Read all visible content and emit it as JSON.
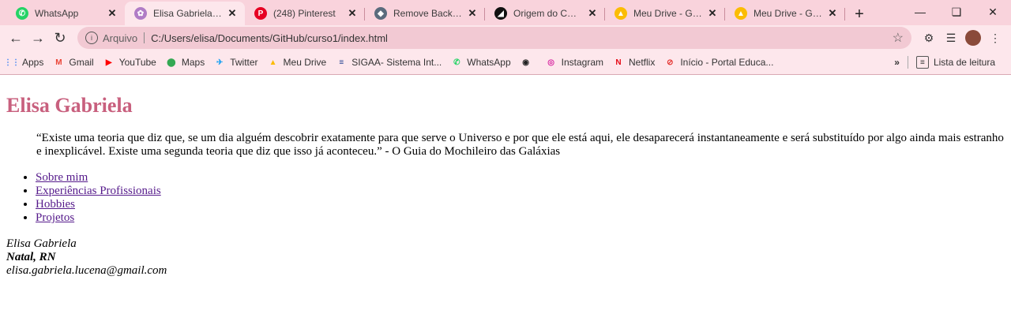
{
  "tabs": [
    {
      "title": "WhatsApp",
      "icon": "whatsapp-icon",
      "color": "#25d366"
    },
    {
      "title": "Elisa Gabriela Luce",
      "icon": "page-icon",
      "color": "#b07cc6",
      "active": true
    },
    {
      "title": "(248) Pinterest",
      "icon": "pinterest-icon",
      "color": "#e60023"
    },
    {
      "title": "Remove Backgrou",
      "icon": "removebg-icon",
      "color": "#5a6b7d"
    },
    {
      "title": "Origem do CSS | R",
      "icon": "alura-icon",
      "color": "#111111"
    },
    {
      "title": "Meu Drive - Goog",
      "icon": "drive-icon",
      "color": "#fbbc04"
    },
    {
      "title": "Meu Drive - Goog",
      "icon": "drive-icon",
      "color": "#fbbc04"
    }
  ],
  "address": {
    "label": "Arquivo",
    "url": "C:/Users/elisa/Documents/GitHub/curso1/index.html"
  },
  "bookmarks": [
    {
      "label": "Apps",
      "icon": "apps-icon",
      "color": "#4285f4"
    },
    {
      "label": "Gmail",
      "icon": "gmail-icon",
      "color": "#ea4335"
    },
    {
      "label": "YouTube",
      "icon": "youtube-icon",
      "color": "#ff0000"
    },
    {
      "label": "Maps",
      "icon": "maps-icon",
      "color": "#34a853"
    },
    {
      "label": "Twitter",
      "icon": "twitter-icon",
      "color": "#1da1f2"
    },
    {
      "label": "Meu Drive",
      "icon": "drive-icon",
      "color": "#fbbc04"
    },
    {
      "label": "SIGAA- Sistema Int...",
      "icon": "sigaa-icon",
      "color": "#1a3d8f"
    },
    {
      "label": "WhatsApp",
      "icon": "whatsapp-icon",
      "color": "#25d366"
    },
    {
      "label": "",
      "icon": "globe-icon",
      "color": "#222222"
    },
    {
      "label": "Instagram",
      "icon": "instagram-icon",
      "color": "#d6249f"
    },
    {
      "label": "Netflix",
      "icon": "netflix-icon",
      "color": "#e50914"
    },
    {
      "label": "Início - Portal Educa...",
      "icon": "portal-icon",
      "color": "#e53935"
    }
  ],
  "reading_list": "Lista de leitura",
  "page": {
    "heading": "Elisa Gabriela",
    "quote": "“Existe uma teoria que diz que, se um dia alguém descobrir exatamente para que serve o Universo e por que ele está aqui, ele desaparecerá instantaneamente e será substituído por algo ainda mais estranho e inexplicável. Existe uma segunda teoria que diz que isso já aconteceu.” - O Guia do Mochileiro das Galáxias",
    "links": [
      "Sobre mim",
      "Experiências Profissionais",
      "Hobbies",
      "Projetos"
    ],
    "address": {
      "name": "Elisa Gabriela",
      "city": "Natal, RN",
      "email": "elisa.gabriela.lucena@gmail.com"
    }
  }
}
